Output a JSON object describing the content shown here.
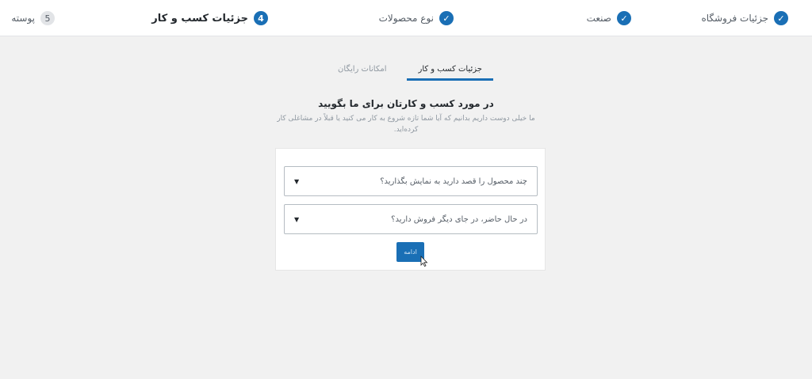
{
  "steps": [
    {
      "label": "جزئیات فروشگاه",
      "state": "done",
      "icon": "check-icon"
    },
    {
      "label": "صنعت",
      "state": "done",
      "icon": "check-icon"
    },
    {
      "label": "نوع محصولات",
      "state": "done",
      "icon": "check-icon"
    },
    {
      "label": "جزئیات کسب و کار",
      "state": "active",
      "number": "4"
    },
    {
      "label": "پوسته",
      "state": "pending",
      "number": "5"
    }
  ],
  "tabs": [
    {
      "label": "جزئیات کسب و کار",
      "active": true
    },
    {
      "label": "امکانات رایگان",
      "active": false
    }
  ],
  "heading": "در مورد کسب و کارتان برای ما بگویید",
  "subtext": "ما خیلی دوست داریم بدانیم که آیا شما تازه شروع به کار می کنید یا قبلاً در مشاغلی کار کرده‌اید.",
  "form": {
    "products_select": "چند محصول را قصد دارید به نمایش بگذارید؟",
    "selling_select": "در حال حاضر، در جای دیگر فروش دارید؟",
    "continue_label": "ادامه"
  },
  "colors": {
    "accent": "#1a6fb5",
    "background": "#f1f1f1"
  }
}
